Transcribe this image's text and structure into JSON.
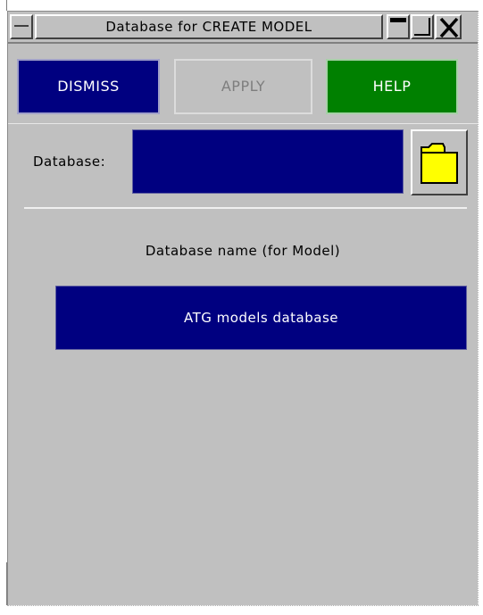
{
  "window": {
    "title": "Database for CREATE MODEL"
  },
  "titlebar_buttons": {
    "system_menu_icon": "dash-icon",
    "minimize_icon": "minimize-icon",
    "maximize_icon": "maximize-icon",
    "close_icon": "close-icon"
  },
  "actions": {
    "dismiss_label": "DISMISS",
    "apply_label": "APPLY",
    "help_label": "HELP"
  },
  "database": {
    "label": "Database:",
    "value": "",
    "browse_icon": "folder-icon"
  },
  "database_name": {
    "label": "Database name (for Model)",
    "value": "ATG models database"
  },
  "colors": {
    "field_background": "#000080",
    "dismiss_background": "#000080",
    "help_background": "#008000",
    "window_background": "#c0c0c0",
    "folder_fill": "#ffff00"
  }
}
